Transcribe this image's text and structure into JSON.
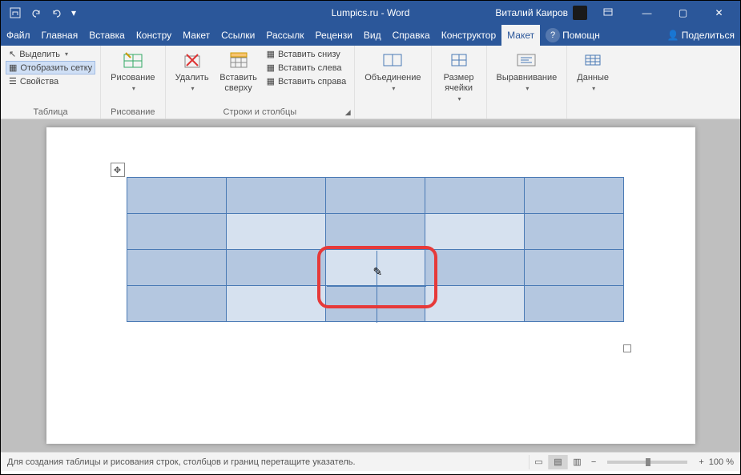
{
  "titlebar": {
    "title": "Lumpics.ru - Word",
    "user": "Виталий Каиров"
  },
  "wincontrols": {
    "min": "—",
    "max": "▢",
    "close": "✕"
  },
  "menubar": {
    "file": "Файл",
    "home": "Главная",
    "insert": "Вставка",
    "design": "Констру",
    "layout": "Макет",
    "references": "Ссылки",
    "mailings": "Рассылк",
    "review": "Рецензи",
    "view": "Вид",
    "help": "Справка",
    "table_design": "Конструктор",
    "table_layout": "Макет",
    "tell_me": "Помощн",
    "share": "Поделиться"
  },
  "ribbon": {
    "table": {
      "label": "Таблица",
      "select": "Выделить",
      "show_grid": "Отобразить сетку",
      "properties": "Свойства"
    },
    "draw": {
      "label": "Рисование",
      "draw": "Рисование"
    },
    "rows_cols": {
      "label": "Строки и столбцы",
      "delete": "Удалить",
      "insert_above": "Вставить сверху",
      "insert_below": "Вставить снизу",
      "insert_left": "Вставить слева",
      "insert_right": "Вставить справа"
    },
    "merge": {
      "label": "Объединение"
    },
    "cell_size": {
      "label": "Размер ячейки"
    },
    "alignment": {
      "label": "Выравнивание"
    },
    "data": {
      "label": "Данные"
    }
  },
  "statusbar": {
    "hint": "Для создания таблицы и рисования строк, столбцов и границ перетащите указатель.",
    "zoom": "100 %"
  }
}
